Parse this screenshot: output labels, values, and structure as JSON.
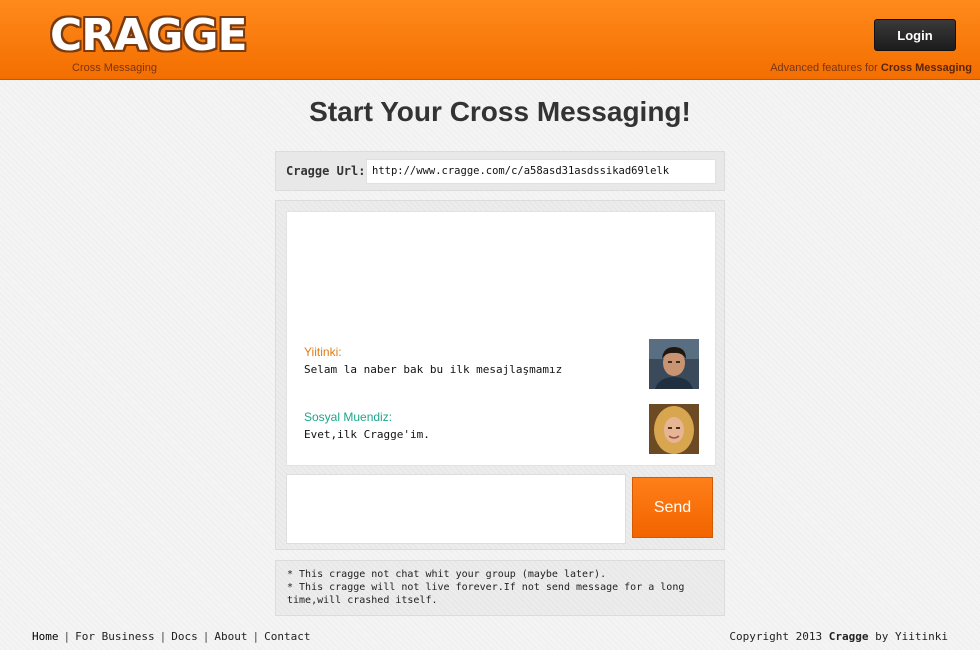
{
  "header": {
    "logo": "CRAGGE",
    "tagline": "Cross Messaging",
    "login_label": "Login",
    "note_prefix": "Advanced features for",
    "note_emphasis": "Cross Messaging"
  },
  "page": {
    "title": "Start Your Cross Messaging!"
  },
  "url_bar": {
    "label": "Cragge Url:",
    "value": "http://www.cragge.com/c/a58asd31asdssikad69lelk"
  },
  "messages": [
    {
      "author": "Yiitinki:",
      "text": "Selam la naber bak bu ilk mesajlaşmamız",
      "author_color": "#e07b16",
      "avatar": "male-avatar"
    },
    {
      "author": "Sosyal Muendiz:",
      "text": "Evet,ilk Cragge'im.",
      "author_color": "#1fa58a",
      "avatar": "female-avatar"
    }
  ],
  "compose": {
    "value": "",
    "send_label": "Send"
  },
  "notes": [
    "* This cragge not chat whit your group (maybe later).",
    "* This cragge will not live forever.If not send message for a long time,will crashed itself."
  ],
  "footer": {
    "nav": [
      "Home",
      "For Business",
      "Docs",
      "About",
      "Contact"
    ],
    "copyright_prefix": "Copyright 2013",
    "copyright_brand": "Cragge",
    "copyright_suffix": "by Yiitinki"
  },
  "colors": {
    "brand": "#f57400",
    "login_bg": "#222222",
    "send_bg": "#f46a00"
  }
}
